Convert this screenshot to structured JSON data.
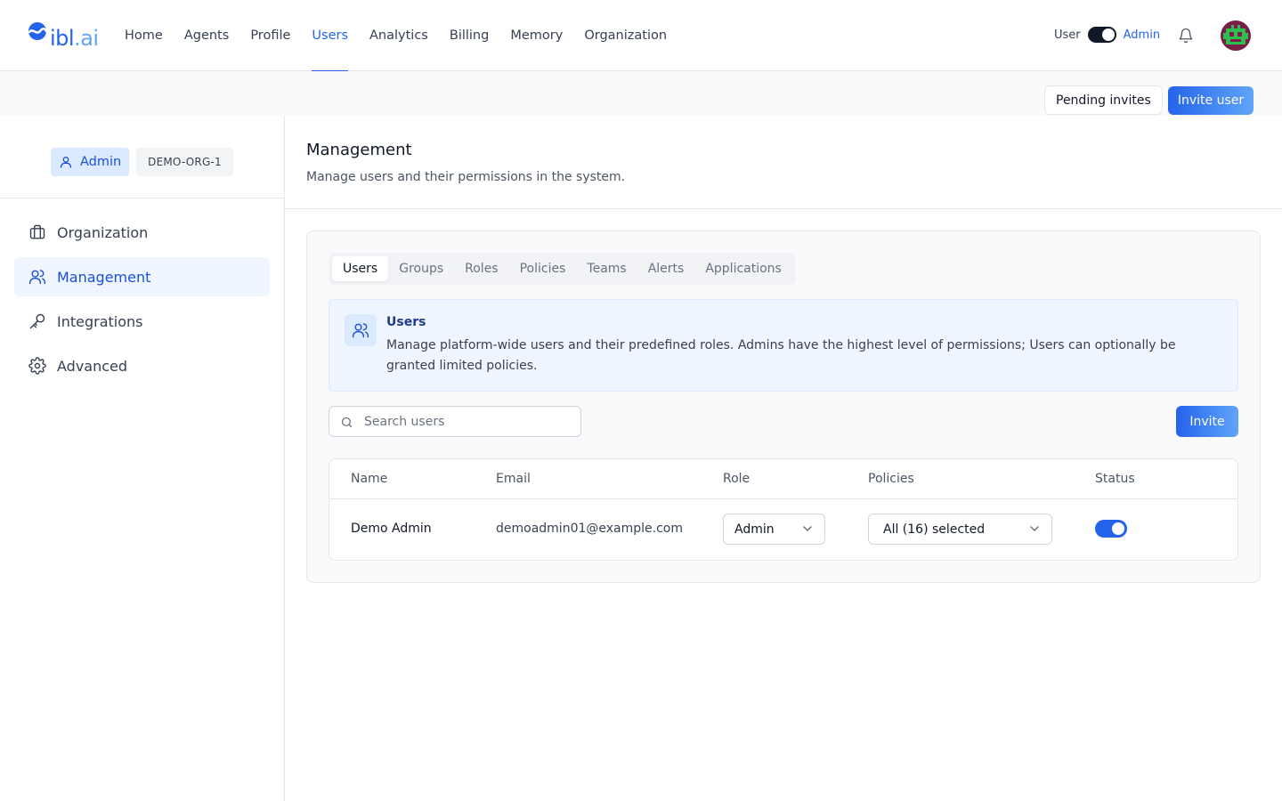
{
  "brand": {
    "name_main": "ibl",
    "name_dim": ".ai"
  },
  "nav": {
    "items": [
      {
        "label": "Home"
      },
      {
        "label": "Agents"
      },
      {
        "label": "Profile"
      },
      {
        "label": "Users",
        "active": true
      },
      {
        "label": "Analytics"
      },
      {
        "label": "Billing"
      },
      {
        "label": "Memory"
      },
      {
        "label": "Organization"
      }
    ],
    "mode_user_label": "User",
    "mode_admin_label": "Admin",
    "mode_selected": "Admin"
  },
  "actions": {
    "pending_invites_label": "Pending invites",
    "invite_user_label": "Invite user"
  },
  "sidebar": {
    "role_badge": "Admin",
    "org_badge": "DEMO-ORG-1",
    "items": [
      {
        "label": "Organization",
        "icon": "briefcase-icon"
      },
      {
        "label": "Management",
        "icon": "users-icon",
        "active": true
      },
      {
        "label": "Integrations",
        "icon": "key-icon"
      },
      {
        "label": "Advanced",
        "icon": "gear-icon"
      }
    ]
  },
  "main": {
    "title": "Management",
    "subtitle": "Manage users and their permissions in the system.",
    "tabs": [
      {
        "label": "Users",
        "active": true
      },
      {
        "label": "Groups"
      },
      {
        "label": "Roles"
      },
      {
        "label": "Policies"
      },
      {
        "label": "Teams"
      },
      {
        "label": "Alerts"
      },
      {
        "label": "Applications"
      }
    ],
    "info": {
      "title": "Users",
      "text": "Manage platform-wide users and their predefined roles. Admins have the highest level of permissions; Users can optionally be granted limited policies."
    },
    "search": {
      "placeholder": "Search users",
      "value": ""
    },
    "invite_label": "Invite",
    "table": {
      "columns": [
        "Name",
        "Email",
        "Role",
        "Policies",
        "Status"
      ],
      "rows": [
        {
          "name": "Demo Admin",
          "email": "demoadmin01@example.com",
          "role": "Admin",
          "policies": "All (16) selected",
          "status_enabled": true
        }
      ]
    }
  },
  "colors": {
    "accent": "#2563eb",
    "accent_light": "#60a5fa",
    "active_bg": "#eff6ff",
    "border": "#e5e7eb"
  }
}
